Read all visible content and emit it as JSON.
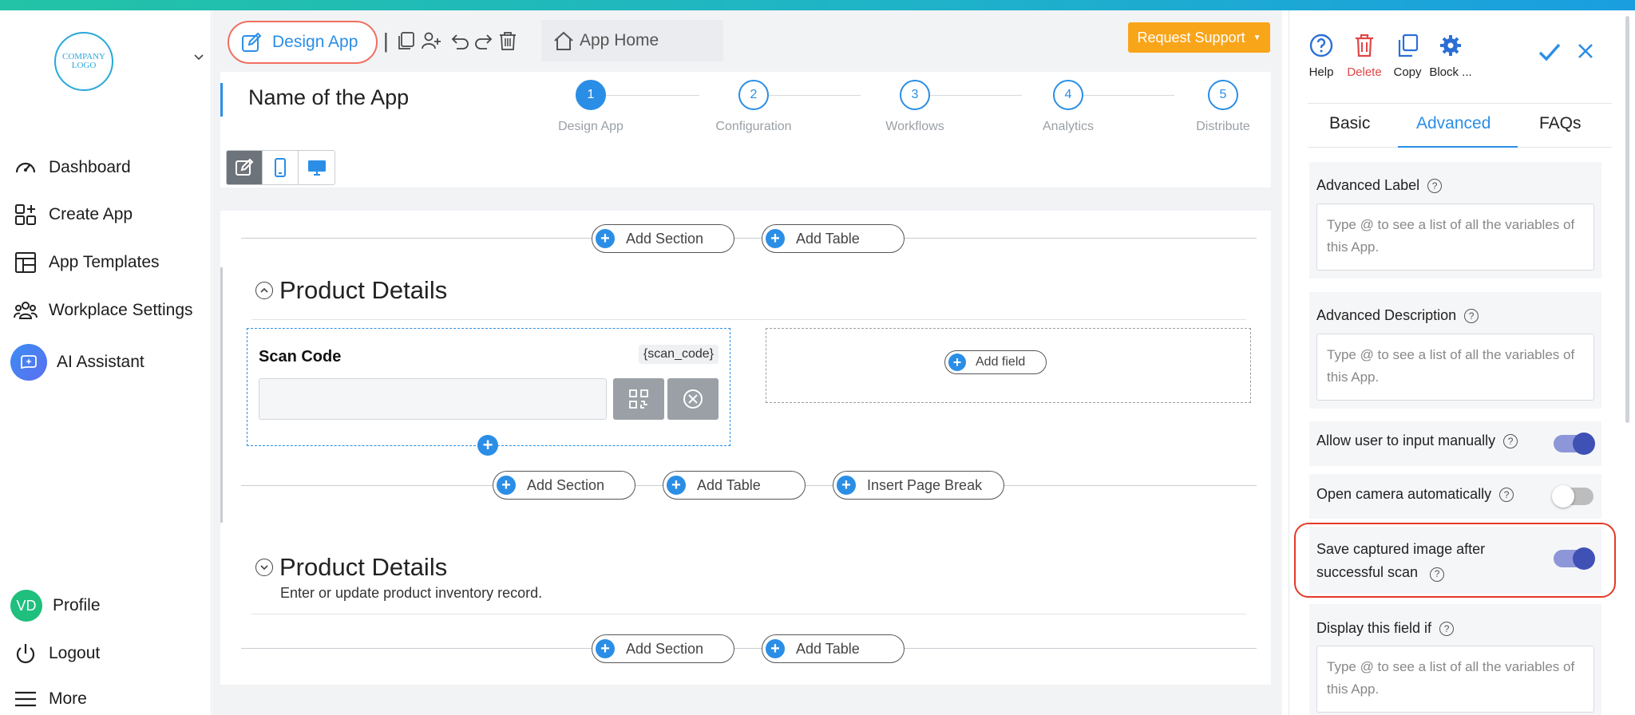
{
  "sidebar": {
    "logo_text": "COMPANY LOGO",
    "items": [
      {
        "label": "Dashboard",
        "icon": "gauge-icon"
      },
      {
        "label": "Create App",
        "icon": "grid-plus-icon"
      },
      {
        "label": "App Templates",
        "icon": "template-icon"
      },
      {
        "label": "Workplace Settings",
        "icon": "users-gear-icon"
      },
      {
        "label": "AI Assistant",
        "icon": "ai-sparkle-icon"
      }
    ],
    "profile": {
      "initials": "VD",
      "label": "Profile"
    },
    "logout_label": "Logout",
    "more_label": "More"
  },
  "toolbar": {
    "design_app_label": "Design App",
    "separator": "|",
    "app_home_label": "App Home",
    "request_support_label": "Request Support"
  },
  "app": {
    "name": "Name of the App",
    "steps": [
      {
        "num": "1",
        "label": "Design App",
        "active": true
      },
      {
        "num": "2",
        "label": "Configuration",
        "active": false
      },
      {
        "num": "3",
        "label": "Workflows",
        "active": false
      },
      {
        "num": "4",
        "label": "Analytics",
        "active": false
      },
      {
        "num": "5",
        "label": "Distribute",
        "active": false
      }
    ]
  },
  "canvas": {
    "add_section": "Add Section",
    "add_table": "Add Table",
    "insert_page_break": "Insert Page Break",
    "add_field": "Add field",
    "section1": {
      "title": "Product Details"
    },
    "section2": {
      "title": "Product Details",
      "subtitle": "Enter or update product inventory record."
    },
    "field": {
      "label": "Scan Code",
      "tag": "{scan_code}",
      "value": ""
    }
  },
  "panel": {
    "tools": [
      {
        "label": "Help"
      },
      {
        "label": "Delete"
      },
      {
        "label": "Copy"
      },
      {
        "label": "Block ..."
      }
    ],
    "tabs": [
      "Basic",
      "Advanced",
      "FAQs"
    ],
    "active_tab": "Advanced",
    "advanced_label": {
      "label": "Advanced Label",
      "placeholder": "Type @ to see a list of all the variables of this App."
    },
    "advanced_description": {
      "label": "Advanced Description",
      "placeholder": "Type @ to see a list of all the variables of this App."
    },
    "toggles": [
      {
        "label": "Allow user to input manually",
        "on": true
      },
      {
        "label": "Open camera automatically",
        "on": false
      },
      {
        "label": "Save captured image after successful scan",
        "on": true
      }
    ],
    "display_if": {
      "label": "Display this field if",
      "placeholder": "Type @ to see a list of all the variables of this App."
    },
    "help_glyph": "?"
  },
  "colors": {
    "accent": "#2b8ee6",
    "warning": "#f9a51a",
    "danger": "#e04646",
    "toggle_on": "#3f51b5",
    "highlight": "#e53a27"
  }
}
